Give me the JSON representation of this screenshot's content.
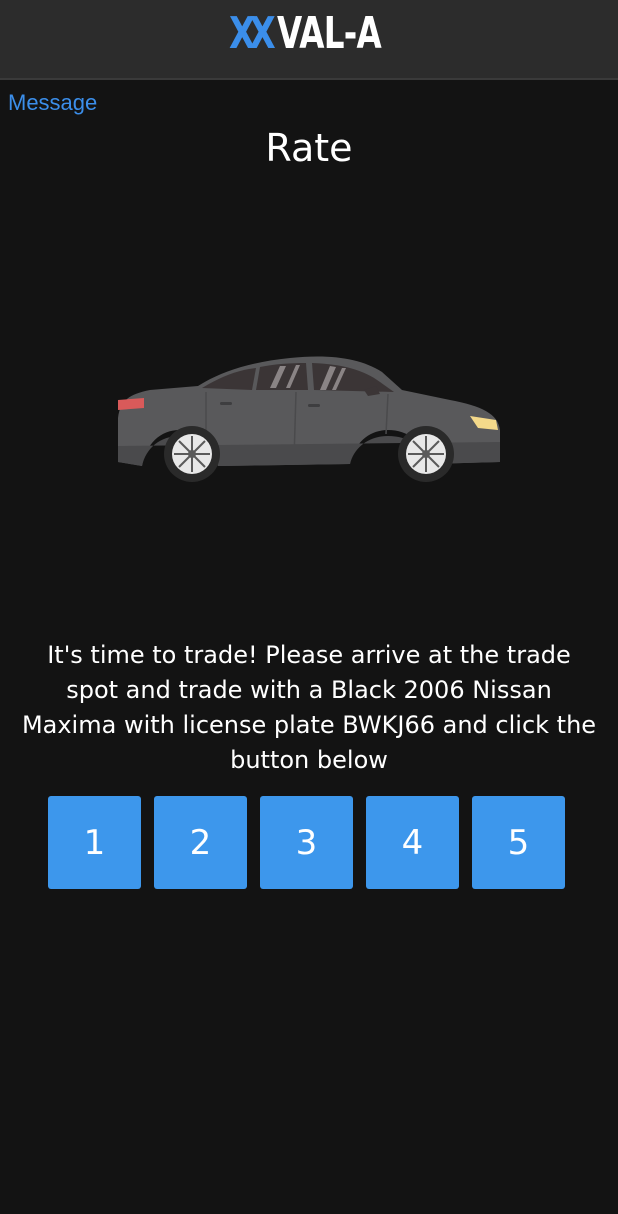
{
  "header": {
    "logo_mark": "XX",
    "logo_text": "VAL-A"
  },
  "nav": {
    "back_link": "Message"
  },
  "page": {
    "title": "Rate",
    "image": "car-icon",
    "instruction": "It's time to trade! Please arrive at the trade spot and trade with a Black 2006 Nissan Maxima with license plate BWKJ66 and click the button below"
  },
  "rating": {
    "buttons": [
      "1",
      "2",
      "3",
      "4",
      "5"
    ]
  },
  "colors": {
    "background": "#131313",
    "header_bg": "#2c2c2c",
    "accent": "#3d97ec",
    "link": "#3b8eea",
    "car_body": "#5a5a5c"
  }
}
